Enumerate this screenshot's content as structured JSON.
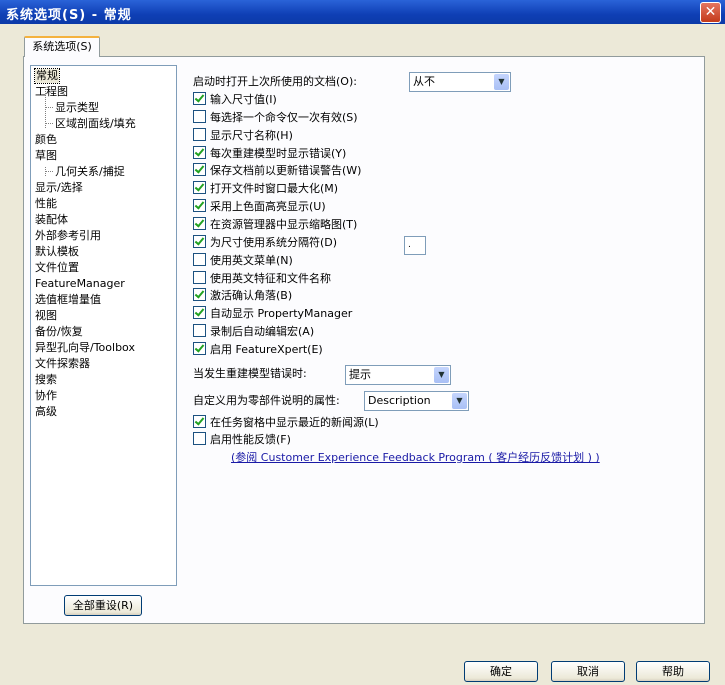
{
  "window": {
    "title": "系统选项(S) - 常规",
    "close_glyph": "✕"
  },
  "tab": {
    "label": "系统选项(S)"
  },
  "tree": {
    "items": [
      "常规",
      "工程图",
      "显示类型",
      "区域剖面线/填充",
      "颜色",
      "草图",
      "几何关系/捕捉",
      "显示/选择",
      "性能",
      "装配体",
      "外部参考引用",
      "默认模板",
      "文件位置",
      "FeatureManager",
      "选值框增量值",
      "视图",
      "备份/恢复",
      "异型孔向导/Toolbox",
      "文件探索器",
      "搜索",
      "协作",
      "高级"
    ]
  },
  "reset_button": "全部重设(R)",
  "open_docs": {
    "label": "启动时打开上次所使用的文档(O):",
    "value": "从不"
  },
  "options": [
    {
      "label": "输入尺寸值(I)",
      "checked": true
    },
    {
      "label": "每选择一个命令仅一次有效(S)",
      "checked": false
    },
    {
      "label": "显示尺寸名称(H)",
      "checked": false
    },
    {
      "label": "每次重建模型时显示错误(Y)",
      "checked": true
    },
    {
      "label": "保存文档前以更新错误警告(W)",
      "checked": true
    },
    {
      "label": "打开文件时窗口最大化(M)",
      "checked": true
    },
    {
      "label": "采用上色面高亮显示(U)",
      "checked": true
    },
    {
      "label": "在资源管理器中显示缩略图(T)",
      "checked": true
    },
    {
      "label": "为尺寸使用系统分隔符(D)",
      "checked": true
    },
    {
      "label": "使用英文菜单(N)",
      "checked": false
    },
    {
      "label": "使用英文特征和文件名称",
      "checked": false
    },
    {
      "label": "激活确认角落(B)",
      "checked": true
    },
    {
      "label": "自动显示 PropertyManager",
      "checked": true
    },
    {
      "label": "录制后自动编辑宏(A)",
      "checked": false
    },
    {
      "label": "启用 FeatureXpert(E)",
      "checked": true
    }
  ],
  "separator_value": ".",
  "rebuild_error": {
    "label": "当发生重建模型错误时:",
    "value": "提示"
  },
  "description_prop": {
    "label": "自定义用为零部件说明的属性:",
    "value": "Description"
  },
  "options2": [
    {
      "label": "在任务窗格中显示最近的新闻源(L)",
      "checked": true
    },
    {
      "label": "启用性能反馈(F)",
      "checked": false
    }
  ],
  "feedback_link": "(参阅 Customer Experience Feedback Program ( 客户经历反馈计划 ) )",
  "footer": {
    "ok": "确定",
    "cancel": "取消",
    "help": "帮助"
  }
}
